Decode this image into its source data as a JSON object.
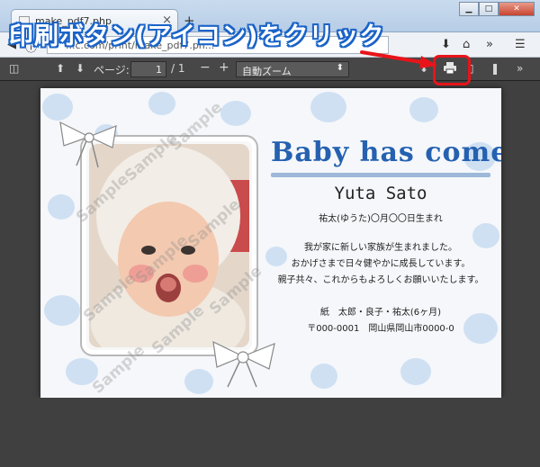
{
  "browser": {
    "tab_title": "make_pdf7.php",
    "url_fragment": "...c.com/print/make_pdf7.ph...",
    "window_controls": {
      "minimize": "▁",
      "maximize": "□",
      "close": "✕"
    }
  },
  "annotation": {
    "text": "印刷ボタン(アイコン)をクリック",
    "color": "#e8141a"
  },
  "pdf_toolbar": {
    "page_label": "ページ:",
    "page_current": "1",
    "page_total": "/ 1",
    "zoom_value": "自動ズーム"
  },
  "card": {
    "title": "Baby has come!",
    "name": "Yuta Sato",
    "birth": "祐太(ゆうた)〇月〇〇日生まれ",
    "message_lines": [
      "我が家に新しい家族が生まれました。",
      "おかげさまで日々健やかに成長しています。",
      "親子共々、これからもよろしくお願いいたします。"
    ],
    "family": "紙　太郎・良子・祐太(6ヶ月)",
    "address": "〒000-0001　岡山県岡山市0000-0",
    "watermark": "Sample",
    "colors": {
      "title": "#2561b0",
      "pattern": "#cfe0f3"
    }
  }
}
